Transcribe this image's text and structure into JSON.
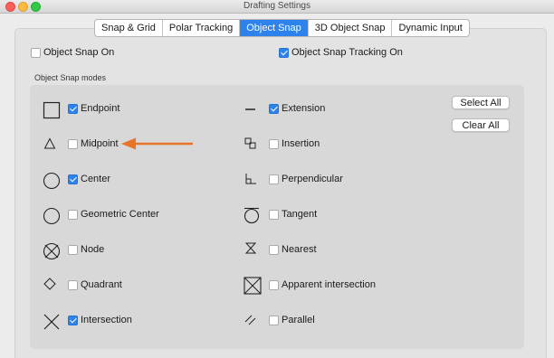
{
  "window": {
    "title": "Drafting Settings"
  },
  "tabs": [
    "Snap & Grid",
    "Polar Tracking",
    "Object Snap",
    "3D Object Snap",
    "Dynamic Input"
  ],
  "active_tab": "Object Snap",
  "top_options": {
    "snap_on": {
      "label": "Object Snap On",
      "checked": false
    },
    "tracking_on": {
      "label": "Object Snap Tracking On",
      "checked": true
    }
  },
  "group_label": "Object Snap modes",
  "left_modes": [
    {
      "label": "Endpoint",
      "checked": true,
      "icon": "endpoint-icon"
    },
    {
      "label": "Midpoint",
      "checked": false,
      "icon": "midpoint-icon"
    },
    {
      "label": "Center",
      "checked": true,
      "icon": "center-icon"
    },
    {
      "label": "Geometric Center",
      "checked": false,
      "icon": "geometric-center-icon"
    },
    {
      "label": "Node",
      "checked": false,
      "icon": "node-icon"
    },
    {
      "label": "Quadrant",
      "checked": false,
      "icon": "quadrant-icon"
    },
    {
      "label": "Intersection",
      "checked": true,
      "icon": "intersection-icon"
    }
  ],
  "right_modes": [
    {
      "label": "Extension",
      "checked": true,
      "icon": "extension-icon"
    },
    {
      "label": "Insertion",
      "checked": false,
      "icon": "insertion-icon"
    },
    {
      "label": "Perpendicular",
      "checked": false,
      "icon": "perpendicular-icon"
    },
    {
      "label": "Tangent",
      "checked": false,
      "icon": "tangent-icon"
    },
    {
      "label": "Nearest",
      "checked": false,
      "icon": "nearest-icon"
    },
    {
      "label": "Apparent intersection",
      "checked": false,
      "icon": "apparent-intersection-icon"
    },
    {
      "label": "Parallel",
      "checked": false,
      "icon": "parallel-icon"
    }
  ],
  "buttons": {
    "select_all": "Select All",
    "clear_all": "Clear All"
  },
  "colors": {
    "accent": "#2e82ec",
    "arrow": "#e8742a"
  }
}
